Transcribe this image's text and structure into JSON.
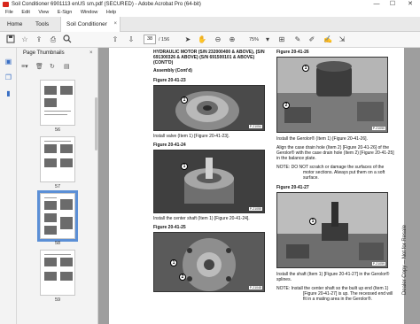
{
  "window": {
    "title": "Soil Conditioner 6901113 enUS sm.pdf (SECURED) - Adobe Acrobat Pro (64-bit)",
    "controls": [
      "—",
      "☐",
      "✕"
    ]
  },
  "menu": [
    "File",
    "Edit",
    "View",
    "E-Sign",
    "Window",
    "Help"
  ],
  "tabs": {
    "home": "Home",
    "tools": "Tools",
    "document": "Soil Conditioner 69...",
    "close": "×"
  },
  "toolbar": {
    "current_page": "38",
    "total_pages": "/ 156",
    "zoom": "75%"
  },
  "thumbnail_panel": {
    "title": "Page Thumbnails",
    "close": "×",
    "pages": [
      {
        "label": "56"
      },
      {
        "label": "57"
      },
      {
        "label": "58",
        "active": true
      },
      {
        "label": "59"
      }
    ]
  },
  "document": {
    "left_column": {
      "heading": "HYDRAULIC MOTOR (S/N 232000400 & ABOVE), (S/N 691300326 & ABOVE) (S/N 691500101 & ABOVE) (CONT'D)",
      "subheading": "Assembly (Cont'd)",
      "figures": [
        {
          "label": "Figure 20-41-23",
          "code": "P-21054",
          "callouts": [
            "1"
          ],
          "caption": "Install valve (Item 1) [Figure 20-41-23]."
        },
        {
          "label": "Figure 20-41-24",
          "code": "P-21055",
          "callouts": [
            "1"
          ],
          "caption": "Install the center shaft (Item 1) [Figure 20-41-24]."
        },
        {
          "label": "Figure 20-41-25",
          "code": "P-21048",
          "callouts": [
            "1",
            "2"
          ],
          "caption": ""
        }
      ]
    },
    "right_column": {
      "figures": [
        {
          "label": "Figure 20-41-26",
          "code": "P-21050",
          "callouts": [
            "1",
            "2"
          ]
        },
        {
          "label": "Figure 20-41-27",
          "code": "P-21059",
          "callouts": [
            "1"
          ]
        }
      ],
      "text1": "Install the Gerolor® (Item 1) [Figure 20-41-26].",
      "text2": "Align the case drain hole (Item 2) [Figure 20-41-26] of the Gerolor® with the case drain hole (Item 2) [Figure 20-41-25] in the balance plate.",
      "note1": "NOTE: DO NOT scratch or damage the surfaces of the motor sections. Always put them on a soft surface.",
      "text3": "Install the shaft (Item 1) [Figure 20-41-27] in the Gerolor® splines.",
      "note2": "NOTE: Install the center shaft so the built up end (Item 1) [Figure 20-41-27] is up. The recessed end will fit in a mating area in the Gerolor®."
    },
    "side_text": "Dealer Copy -- Not for Resale"
  },
  "colors": {
    "accent_blue": "#3a6fc4",
    "acrobat_red": "#d8271c",
    "doc_background": "#9e9e9e"
  }
}
